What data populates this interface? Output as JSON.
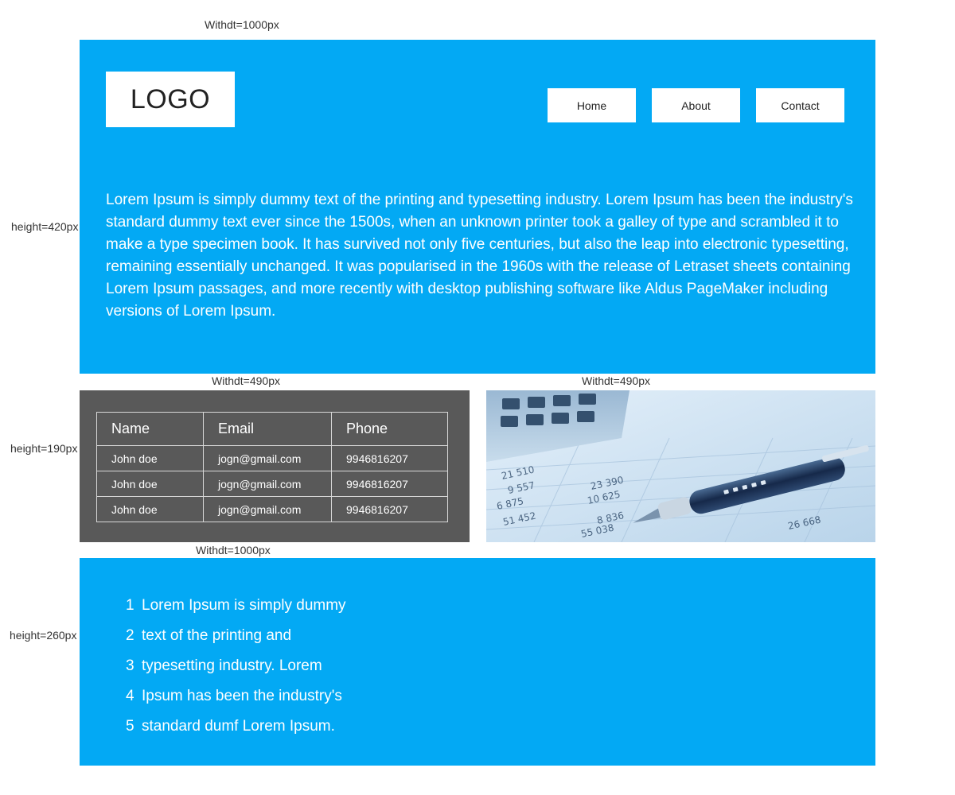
{
  "dimensions": {
    "header_width": "Withdt=1000px",
    "header_height": "height=420px",
    "table_width": "Withdt=490px",
    "image_width": "Withdt=490px",
    "middle_height": "height=190px",
    "footer_width": "Withdt=1000px",
    "footer_height": "height=260px"
  },
  "header": {
    "logo": "LOGO",
    "nav": [
      "Home",
      "About",
      "Contact"
    ],
    "body_text": "Lorem Ipsum is simply dummy text of the printing and typesetting industry. Lorem Ipsum has been the industry's standard dummy text ever since the 1500s, when an unknown printer took a galley of type and scrambled it to make a type specimen book. It has survived not only five centuries, but also the leap into electronic typesetting, remaining essentially unchanged. It was popularised in the 1960s with the release of Letraset sheets containing Lorem Ipsum passages, and more recently with desktop publishing software like Aldus PageMaker including versions of Lorem Ipsum."
  },
  "table": {
    "headers": [
      "Name",
      "Email",
      "Phone"
    ],
    "rows": [
      [
        "John doe",
        "jogn@gmail.com",
        "9946816207"
      ],
      [
        "John doe",
        "jogn@gmail.com",
        "9946816207"
      ],
      [
        "John doe",
        "jogn@gmail.com",
        "9946816207"
      ]
    ]
  },
  "image": {
    "icon": "calculator-pen-financial-photo"
  },
  "list": {
    "items": [
      {
        "num": "1",
        "text": "Lorem Ipsum is simply dummy"
      },
      {
        "num": "2",
        "text": "text of the printing and"
      },
      {
        "num": "3",
        "text": "typesetting industry. Lorem"
      },
      {
        "num": "4",
        "text": "Ipsum has been the industry's"
      },
      {
        "num": "5",
        "text": "standard dumf Lorem Ipsum."
      }
    ]
  },
  "colors": {
    "accent": "#03a9f4",
    "table_bg": "#595959",
    "text_on_accent": "#ffffff"
  }
}
